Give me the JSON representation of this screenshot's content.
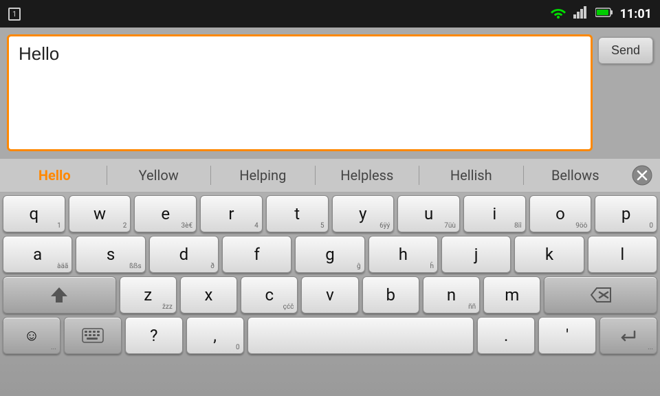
{
  "status_bar": {
    "notification_icon": "1",
    "time": "11:01"
  },
  "message_area": {
    "input_text": "Hello",
    "send_label": "Send"
  },
  "suggestions": [
    {
      "id": "hello",
      "text": "Hello",
      "active": true
    },
    {
      "id": "yellow",
      "text": "Yellow",
      "active": false
    },
    {
      "id": "helping",
      "text": "Helping",
      "active": false
    },
    {
      "id": "helpless",
      "text": "Helpless",
      "active": false
    },
    {
      "id": "hellish",
      "text": "Hellish",
      "active": false
    },
    {
      "id": "bellows",
      "text": "Bellows",
      "active": false
    }
  ],
  "keyboard": {
    "rows": [
      [
        {
          "label": "q",
          "sub": "1"
        },
        {
          "label": "w",
          "sub": "2"
        },
        {
          "label": "e",
          "sub": "3è€"
        },
        {
          "label": "r",
          "sub": "4"
        },
        {
          "label": "t",
          "sub": "5"
        },
        {
          "label": "y",
          "sub": "6ÿý"
        },
        {
          "label": "u",
          "sub": "7üù"
        },
        {
          "label": "i",
          "sub": "8ïî"
        },
        {
          "label": "o",
          "sub": "9öô"
        },
        {
          "label": "p",
          "sub": "0"
        }
      ],
      [
        {
          "label": "a",
          "sub": "àäã"
        },
        {
          "label": "s",
          "sub": "ßẞs"
        },
        {
          "label": "d",
          "sub": "ð"
        },
        {
          "label": "f",
          "sub": ""
        },
        {
          "label": "g",
          "sub": "ĝ"
        },
        {
          "label": "h",
          "sub": "ĥ"
        },
        {
          "label": "j",
          "sub": ""
        },
        {
          "label": "k",
          "sub": ""
        },
        {
          "label": "l",
          "sub": ""
        }
      ],
      [
        {
          "label": "shift",
          "sub": "",
          "special": "shift"
        },
        {
          "label": "z",
          "sub": "žzz"
        },
        {
          "label": "x",
          "sub": ""
        },
        {
          "label": "c",
          "sub": "çćč"
        },
        {
          "label": "v",
          "sub": ""
        },
        {
          "label": "b",
          "sub": ""
        },
        {
          "label": "n",
          "sub": "ññ"
        },
        {
          "label": "m",
          "sub": ""
        },
        {
          "label": "del",
          "sub": "",
          "special": "del"
        }
      ],
      [
        {
          "label": "emoji",
          "sub": "...",
          "special": "emoji"
        },
        {
          "label": "keyboard",
          "sub": "",
          "special": "keyboard"
        },
        {
          "label": "?",
          "sub": ""
        },
        {
          "label": ",",
          "sub": "0"
        },
        {
          "label": "space",
          "sub": "",
          "special": "space"
        },
        {
          "label": ".",
          "sub": ""
        },
        {
          "label": "'",
          "sub": ""
        },
        {
          "label": "enter",
          "sub": "...",
          "special": "enter"
        }
      ]
    ]
  }
}
